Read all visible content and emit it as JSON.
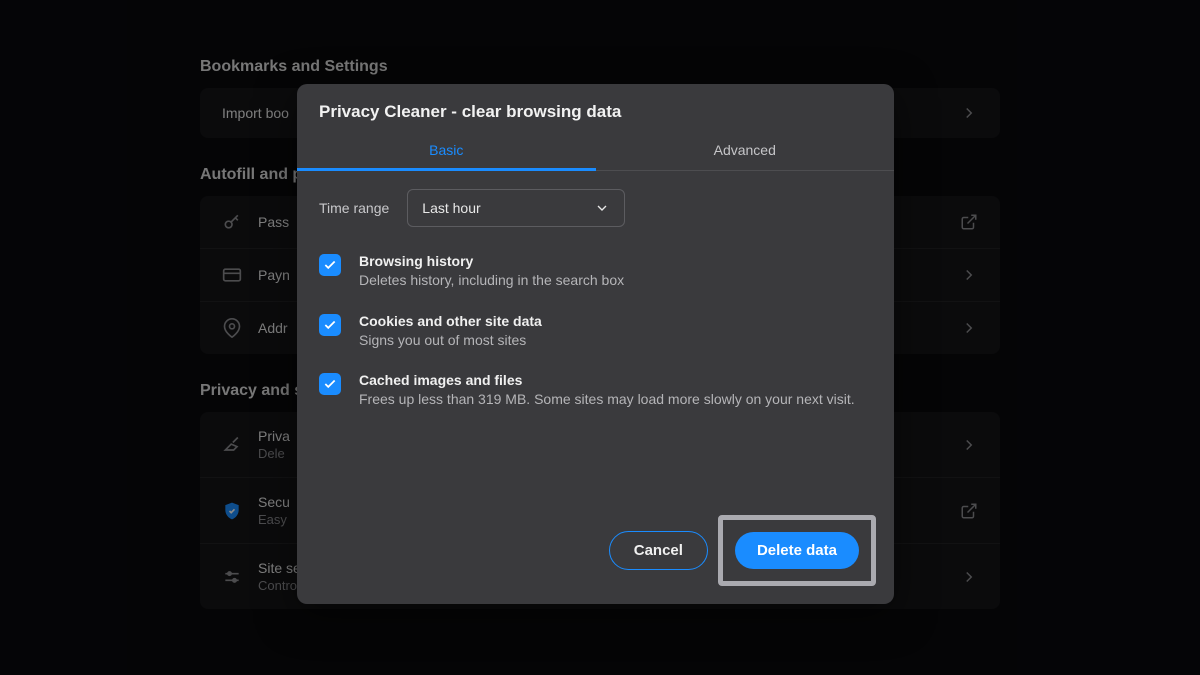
{
  "bg": {
    "sections": {
      "bookmarks": {
        "title": "Bookmarks and Settings",
        "import": "Import boo"
      },
      "autofill": {
        "title": "Autofill and p",
        "rows": {
          "passwords": "Pass",
          "payment": "Payn",
          "addresses": "Addr"
        }
      },
      "privacy": {
        "title": "Privacy and s",
        "rows": {
          "cleaner_title": "Priva",
          "cleaner_sub": "Dele",
          "security_title": "Secu",
          "security_sub": "Easy",
          "site_title": "Site settings",
          "site_sub": "Controls what information sites can use and show (location, camera, pop-ups, and more)"
        }
      }
    }
  },
  "modal": {
    "title": "Privacy Cleaner - clear browsing data",
    "tabs": {
      "basic": "Basic",
      "advanced": "Advanced"
    },
    "range": {
      "label": "Time range",
      "value": "Last hour"
    },
    "options": {
      "history": {
        "title": "Browsing history",
        "desc": "Deletes history, including in the search box"
      },
      "cookies": {
        "title": "Cookies and other site data",
        "desc": "Signs you out of most sites"
      },
      "cache": {
        "title": "Cached images and files",
        "desc": "Frees up less than 319 MB. Some sites may load more slowly on your next visit."
      }
    },
    "buttons": {
      "cancel": "Cancel",
      "delete": "Delete data"
    }
  }
}
